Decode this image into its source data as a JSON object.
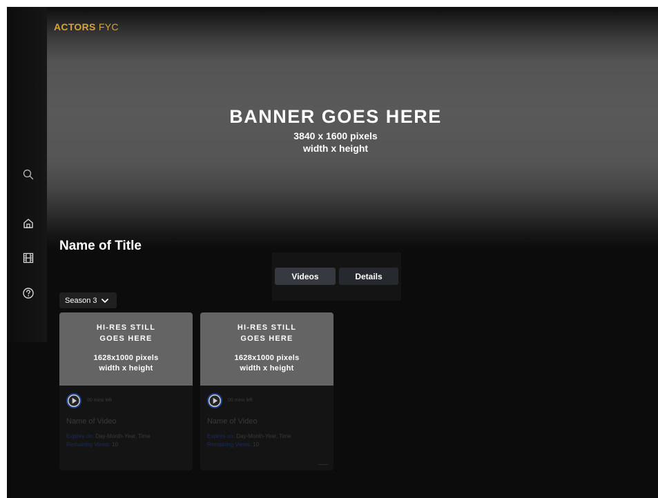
{
  "brand": {
    "logo_bold": "ACTORS",
    "logo_light": " FYC",
    "accent_color": "#d6a437"
  },
  "banner": {
    "title": "BANNER GOES HERE",
    "size": "3840 x 1600 pixels",
    "dims": "width x height"
  },
  "sidebar": {
    "items": [
      {
        "icon": "search-icon"
      },
      {
        "icon": "home-icon"
      },
      {
        "icon": "film-icon"
      },
      {
        "icon": "help-icon"
      }
    ]
  },
  "page": {
    "title": "Name of Title"
  },
  "tabs": [
    {
      "label": "Videos",
      "active": true
    },
    {
      "label": "Details",
      "active": false
    }
  ],
  "season_select": {
    "value": "Season 3"
  },
  "cards": [
    {
      "still_l1": "HI-RES STILL",
      "still_l2": "GOES HERE",
      "still_l3": "1628x1000 pixels",
      "still_l4": "width x height",
      "mins_left": "00 mins left",
      "video_name": "Name of Video",
      "expires_label": "Expires on:",
      "expires_value": " Day-Month-Year, Time",
      "remaining_label": "Remaining Views:",
      "remaining_value": " 10"
    },
    {
      "still_l1": "HI-RES STILL",
      "still_l2": "GOES HERE",
      "still_l3": "1628x1000 pixels",
      "still_l4": "width x height",
      "mins_left": "00 mins left",
      "video_name": "Name of Video",
      "expires_label": "Expires on:",
      "expires_value": " Day-Month-Year, Time",
      "remaining_label": "Remaining Views:",
      "remaining_value": " 10"
    }
  ]
}
